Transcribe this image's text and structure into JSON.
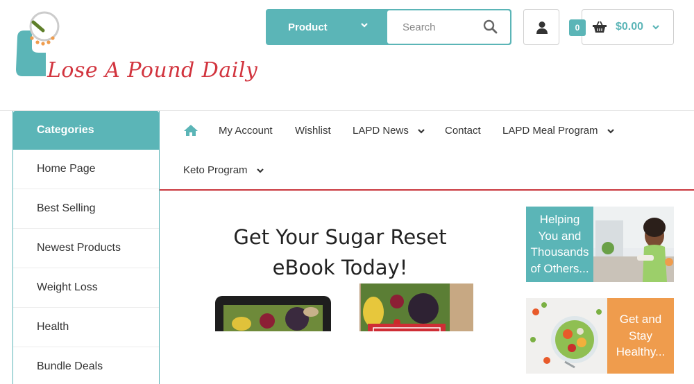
{
  "brand": {
    "logo_text": "Lose A Pound Daily"
  },
  "search": {
    "category_label": "Product",
    "placeholder": "Search"
  },
  "cart": {
    "count": "0",
    "total": "$0.00"
  },
  "sidebar": {
    "heading": "Categories",
    "items": [
      {
        "label": "Home Page"
      },
      {
        "label": "Best Selling"
      },
      {
        "label": "Newest Products"
      },
      {
        "label": "Weight Loss"
      },
      {
        "label": "Health"
      },
      {
        "label": "Bundle Deals"
      }
    ]
  },
  "nav": {
    "items": [
      {
        "label": "My Account"
      },
      {
        "label": "Wishlist"
      },
      {
        "label": "LAPD News"
      },
      {
        "label": "Contact"
      },
      {
        "label": "LAPD Meal Program"
      },
      {
        "label": "Keto Program"
      }
    ]
  },
  "banner": {
    "line1": "Get Your Sugar Reset",
    "line2": "eBook Today!"
  },
  "promos": [
    {
      "lines": [
        "Helping",
        "You and",
        "Thousands",
        "of Others..."
      ]
    },
    {
      "lines": [
        "Get and",
        "Stay",
        "Healthy..."
      ]
    }
  ],
  "colors": {
    "teal": "#5bb5b7",
    "red": "#c9363c",
    "orange": "#ef9c4d",
    "text": "#333333"
  },
  "icons": {
    "search": "search-icon",
    "account": "user-icon",
    "cart": "basket-icon",
    "home": "home-icon",
    "dropdown": "chevron-down-icon"
  }
}
